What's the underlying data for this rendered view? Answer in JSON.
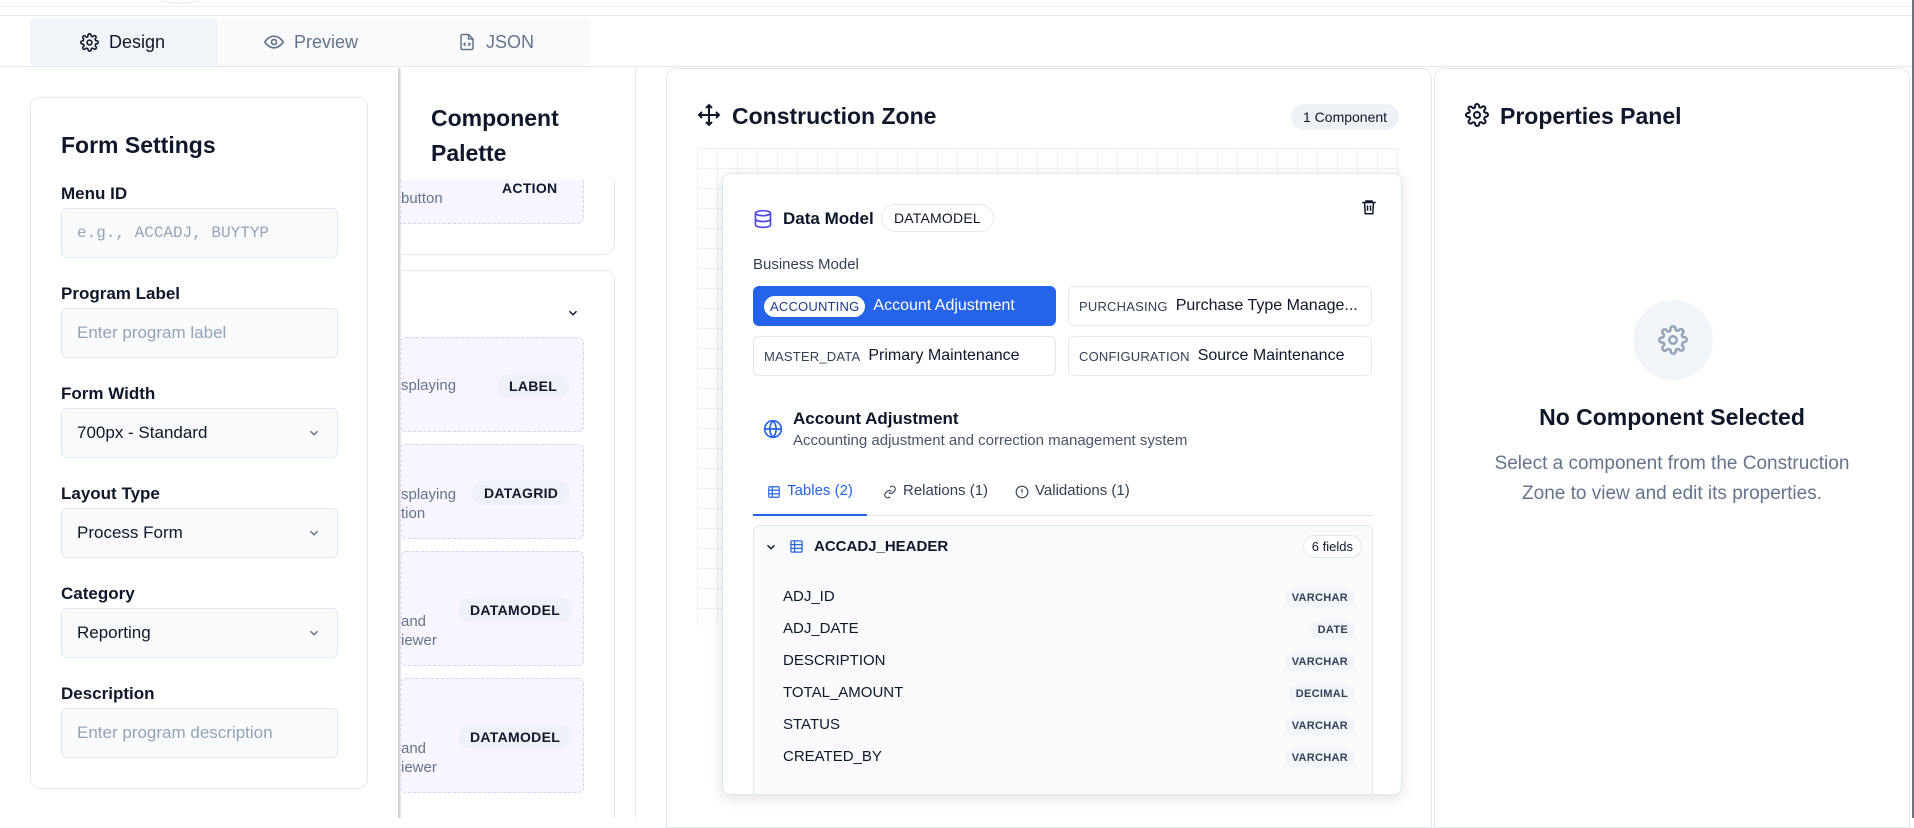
{
  "tabs": [
    {
      "label": "Design",
      "icon": "gear-icon"
    },
    {
      "label": "Preview",
      "icon": "eye-icon"
    },
    {
      "label": "JSON",
      "icon": "file-code-icon"
    }
  ],
  "form_settings": {
    "title": "Form Settings",
    "menu_id": {
      "label": "Menu ID",
      "placeholder": "e.g., ACCADJ, BUYTYP"
    },
    "program_label": {
      "label": "Program Label",
      "placeholder": "Enter program label"
    },
    "form_width": {
      "label": "Form Width",
      "value": "700px - Standard"
    },
    "layout_type": {
      "label": "Layout Type",
      "value": "Process Form"
    },
    "category": {
      "label": "Category",
      "value": "Reporting"
    },
    "description": {
      "label": "Description",
      "placeholder": "Enter program description"
    }
  },
  "palette": {
    "title_line1": "Component",
    "title_line2": "Palette",
    "items": [
      {
        "text1": "button",
        "text2": "",
        "badge": "ACTION"
      },
      {
        "text1": "splaying",
        "text2": "",
        "badge": "LABEL"
      },
      {
        "text1": "splaying",
        "text2": "tion",
        "badge": "DATAGRID"
      },
      {
        "text1": "and",
        "text2": "iewer",
        "badge": "DATAMODEL"
      },
      {
        "text1": "and",
        "text2": "iewer",
        "badge": "DATAMODEL"
      }
    ]
  },
  "construction": {
    "title": "Construction Zone",
    "count_badge": "1 Component",
    "data_model": {
      "title": "Data Model",
      "badge": "DATAMODEL",
      "business_label": "Business Model",
      "models": [
        {
          "tag": "ACCOUNTING",
          "name": "Account Adjustment",
          "selected": true
        },
        {
          "tag": "PURCHASING",
          "name": "Purchase Type Manage...",
          "selected": false
        },
        {
          "tag": "MASTER_DATA",
          "name": "Primary Maintenance",
          "selected": false
        },
        {
          "tag": "CONFIGURATION",
          "name": "Source Maintenance",
          "selected": false
        }
      ],
      "selected_title": "Account Adjustment",
      "selected_desc": "Accounting adjustment and correction management system",
      "subtabs": [
        "Tables (2)",
        "Relations (1)",
        "Validations (1)"
      ],
      "table": {
        "name": "ACCADJ_HEADER",
        "count": "6 fields",
        "fields": [
          {
            "name": "ADJ_ID",
            "type": "VARCHAR"
          },
          {
            "name": "ADJ_DATE",
            "type": "DATE"
          },
          {
            "name": "DESCRIPTION",
            "type": "VARCHAR"
          },
          {
            "name": "TOTAL_AMOUNT",
            "type": "DECIMAL"
          },
          {
            "name": "STATUS",
            "type": "VARCHAR"
          },
          {
            "name": "CREATED_BY",
            "type": "VARCHAR"
          }
        ]
      }
    }
  },
  "properties": {
    "title": "Properties Panel",
    "empty_title": "No Component Selected",
    "empty_line1": "Select a component from the Construction",
    "empty_line2": "Zone to view and edit its properties."
  },
  "colors": {
    "accent": "#2563eb",
    "icon_purple": "#4f46e5"
  }
}
